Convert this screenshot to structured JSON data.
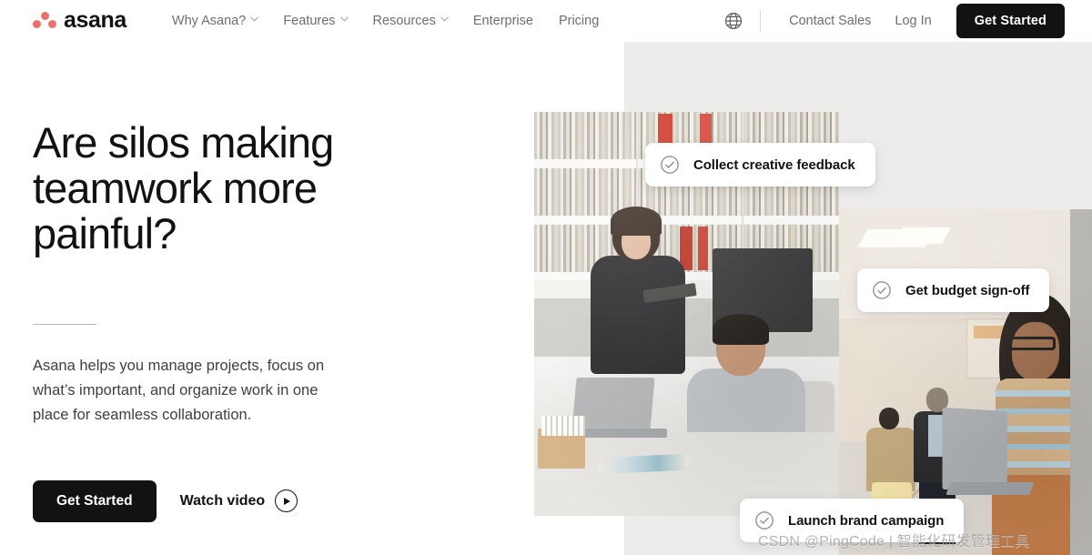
{
  "nav": {
    "logo_text": "asana",
    "logo_color": "#E8726A",
    "links": [
      {
        "label": "Why Asana?",
        "has_caret": true
      },
      {
        "label": "Features",
        "has_caret": true
      },
      {
        "label": "Resources",
        "has_caret": true
      },
      {
        "label": "Enterprise",
        "has_caret": false
      },
      {
        "label": "Pricing",
        "has_caret": false
      }
    ],
    "language_icon": "globe-icon",
    "contact_sales": "Contact Sales",
    "log_in": "Log In",
    "get_started": "Get Started"
  },
  "hero": {
    "headline": "Are silos making\nteamwork more\npainful?",
    "subcopy": "Asana helps you manage projects, focus on\nwhat’s important, and organize work in one\nplace for seamless collaboration.",
    "primary_cta": "Get Started",
    "secondary_cta": "Watch video",
    "play_icon": "play-circle-icon"
  },
  "cards": [
    {
      "icon": "check-circle-icon",
      "label": "Collect creative feedback"
    },
    {
      "icon": "check-circle-icon",
      "label": "Get budget sign-off"
    },
    {
      "icon": "check-circle-icon",
      "label": "Launch brand campaign"
    }
  ],
  "visual": {
    "panel_color": "#EDECEA",
    "photo_left_alt": "Two coworkers in a bright studio office, one seated at a laptop and one standing with a tablet",
    "photo_right_alt": "Woman in a striped shirt holding an open laptop in an open-plan office"
  },
  "watermark": "CSDN @PingCode | 智能化研发管理工具"
}
